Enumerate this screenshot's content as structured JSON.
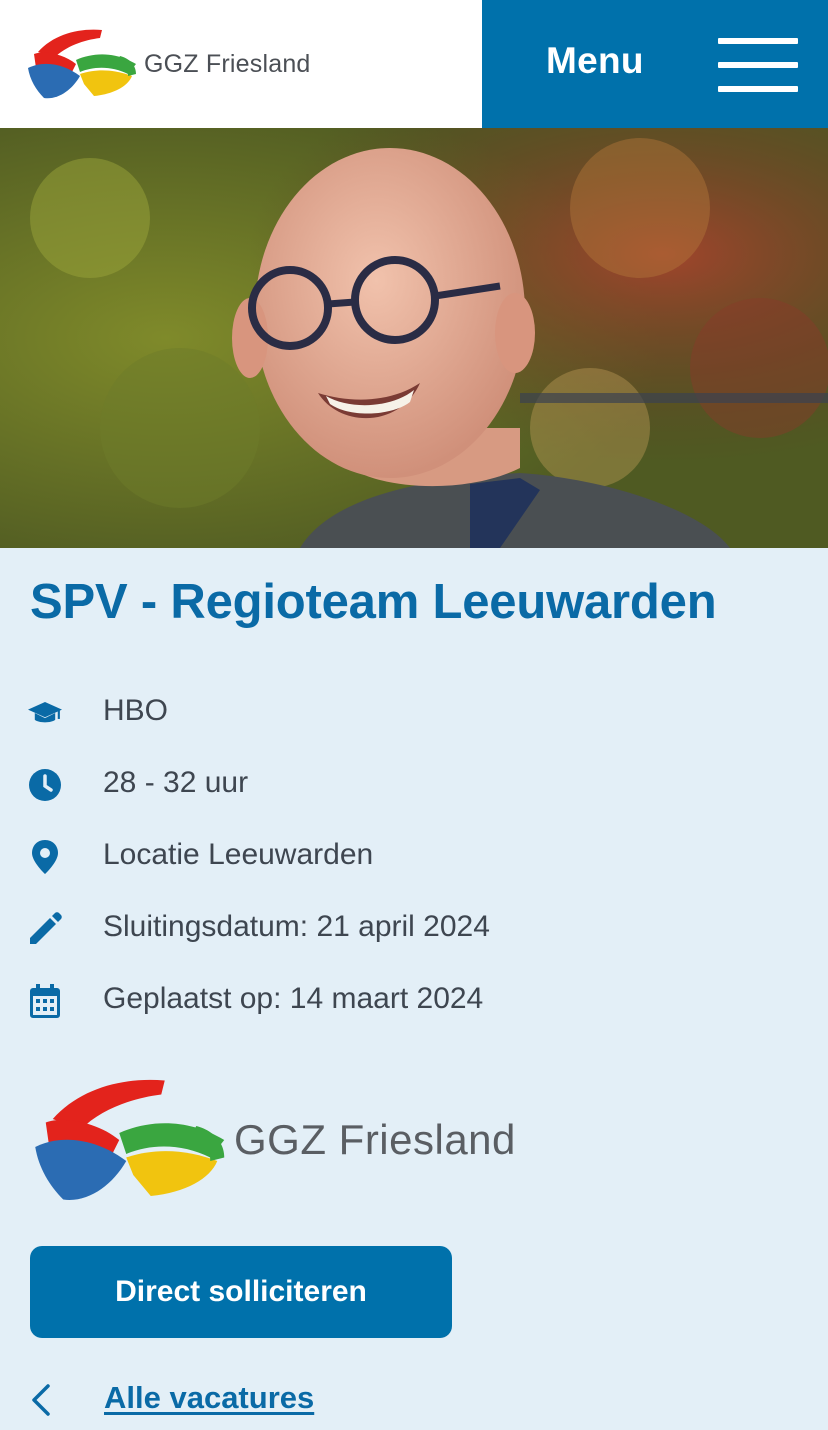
{
  "header": {
    "logo_text": "GGZ Friesland",
    "menu_label": "Menu",
    "brand_color": "#0071ab"
  },
  "hero": {
    "image_description_icon": "portrait-photo"
  },
  "vacancy": {
    "title": "SPV - Regioteam Leeuwarden",
    "details": [
      {
        "icon": "graduation-cap-icon",
        "text": "HBO"
      },
      {
        "icon": "clock-icon",
        "text": "28 - 32 uur"
      },
      {
        "icon": "location-pin-icon",
        "text": "Locatie Leeuwarden"
      },
      {
        "icon": "pencil-icon",
        "text": "Sluitingsdatum: 21 april 2024"
      },
      {
        "icon": "calendar-icon",
        "text": "Geplaatst op: 14 maart 2024"
      }
    ],
    "employer_logo_text": "GGZ Friesland",
    "apply_label": "Direct solliciteren",
    "back_label": "Alle vacatures"
  },
  "colors": {
    "accent": "#0071ab",
    "title": "#0a6aa6",
    "background": "#e3eff7",
    "text": "#3e4650"
  }
}
